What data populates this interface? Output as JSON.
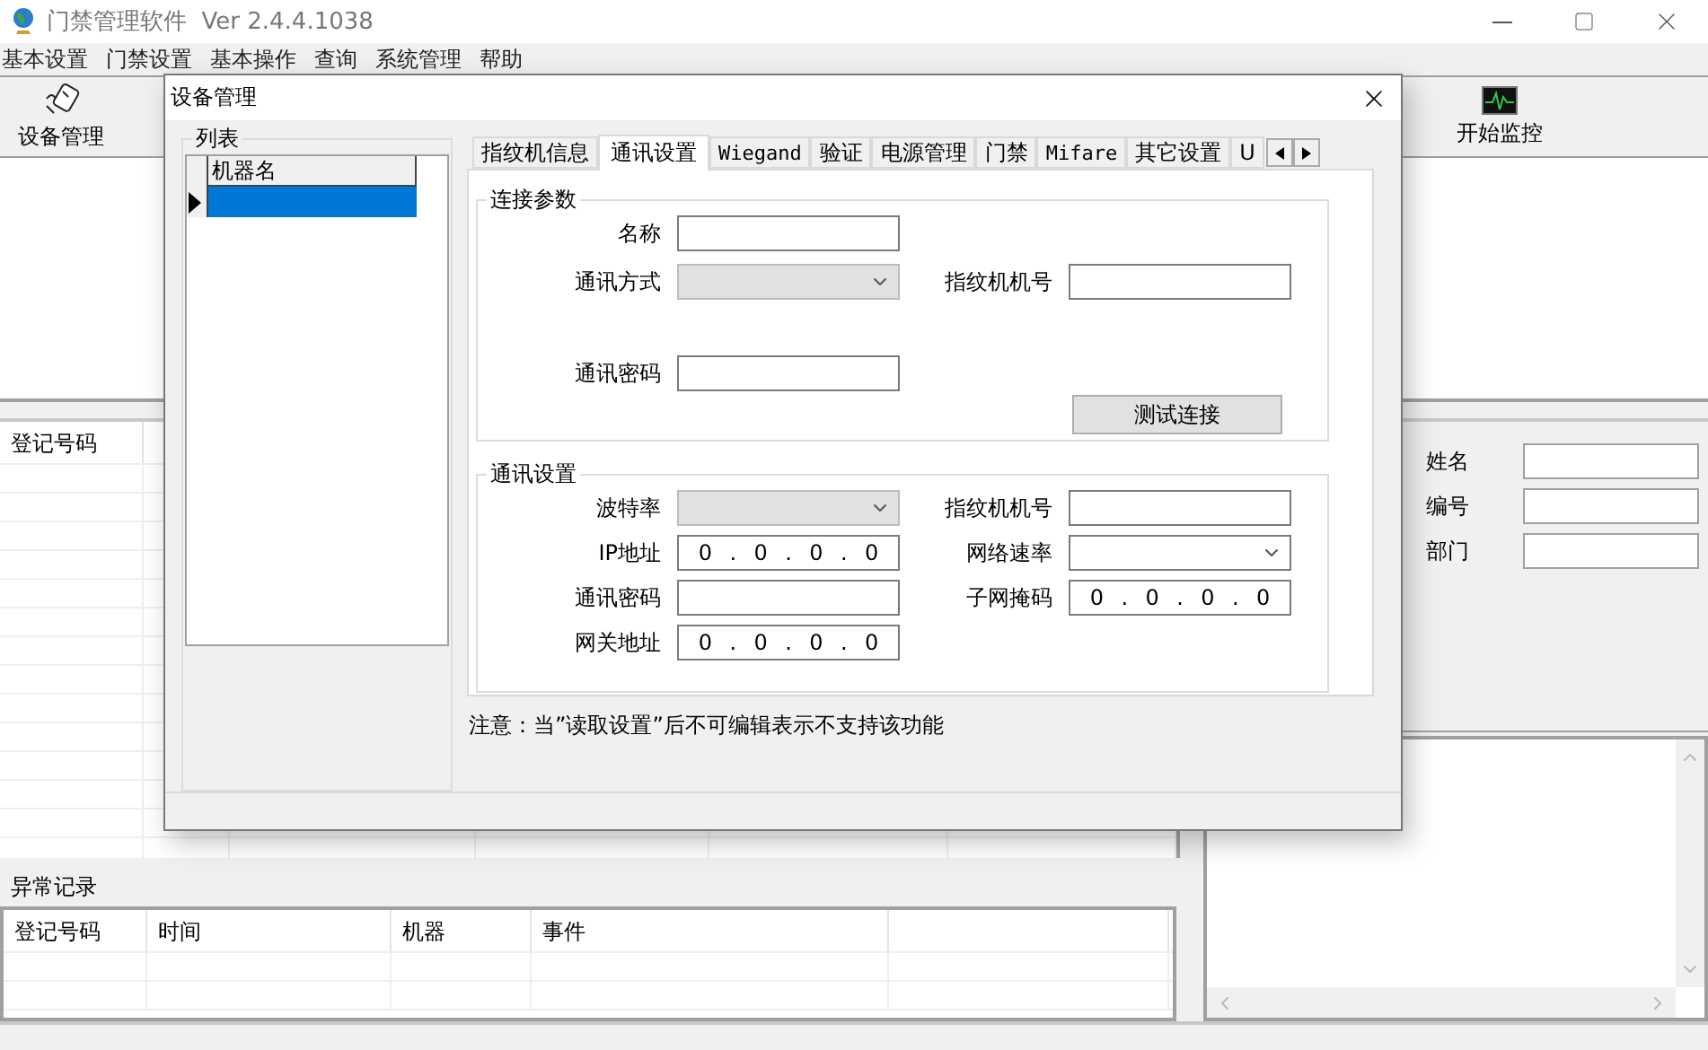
{
  "window": {
    "title": "门禁管理软件",
    "version": "Ver 2.4.4.1038"
  },
  "menu": [
    "基本设置",
    "门禁设置",
    "基本操作",
    "查询",
    "系统管理",
    "帮助"
  ],
  "toolbar": [
    {
      "label": "设备管理",
      "kind": "device"
    },
    {
      "label": "开始监控",
      "kind": "monitor"
    }
  ],
  "records_table": {
    "columns": [
      "登记号码",
      "",
      "",
      "",
      "",
      ""
    ]
  },
  "exceptions": {
    "title": "异常记录",
    "columns": [
      "登记号码",
      "时间",
      "机器",
      "事件",
      ""
    ]
  },
  "person_panel": {
    "fields": [
      {
        "label": "姓名"
      },
      {
        "label": "编号"
      },
      {
        "label": "部门"
      }
    ]
  },
  "dialog": {
    "title": "设备管理",
    "list": {
      "title": "列表",
      "column": "机器名",
      "rows": [
        {
          "selected": true
        }
      ]
    },
    "tabs": [
      {
        "label": "指纹机信息",
        "selected": false
      },
      {
        "label": "通讯设置",
        "selected": true
      },
      {
        "label": "Wiegand",
        "selected": false,
        "kind": "mono"
      },
      {
        "label": "验证",
        "selected": false
      },
      {
        "label": "电源管理",
        "selected": false
      },
      {
        "label": "门禁",
        "selected": false
      },
      {
        "label": "Mifare",
        "selected": false,
        "kind": "mono"
      },
      {
        "label": "其它设置",
        "selected": false
      },
      {
        "label": "U",
        "selected": false
      }
    ],
    "connection": {
      "title": "连接参数",
      "name_label": "名称",
      "method_label": "通讯方式",
      "method_disabled": true,
      "machine_no_label": "指纹机机号",
      "password_label": "通讯密码",
      "test_button": "测试连接"
    },
    "comm": {
      "title": "通讯设置",
      "ip_separator": ".",
      "baud_label": "波特率",
      "baud_disabled": true,
      "machine_no_label": "指纹机机号",
      "ip_label": "IP地址",
      "ip": [
        "0",
        "0",
        "0",
        "0"
      ],
      "speed_label": "网络速率",
      "speed_disabled": false,
      "password_label": "通讯密码",
      "mask_label": "子网掩码",
      "mask": [
        "0",
        "0",
        "0",
        "0"
      ],
      "gateway_label": "网关地址",
      "gateway": [
        "0",
        "0",
        "0",
        "0"
      ]
    },
    "note": "注意：当”读取设置”后不可编辑表示不支持该功能"
  }
}
